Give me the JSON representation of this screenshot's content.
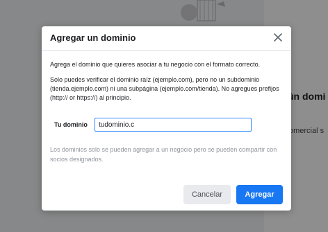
{
  "background": {
    "heading": "ún domi",
    "subtext": "omercial s"
  },
  "dialog": {
    "title": "Agregar un dominio",
    "paragraph1": "Agrega el dominio que quieres asociar a tu negocio con el formato correcto.",
    "paragraph2": "Solo puedes verificar el dominio raíz (ejemplo.com), pero no un subdominio (tienda.ejemplo.com) ni una subpágina (ejemplo.com/tienda). No agregues prefijos (http:// or https://) al principio.",
    "field_label": "Tu dominio",
    "field_value": "tudominio.c",
    "hint": "Los dominios solo se pueden agregar a un negocio pero se pueden compartir con socios designados.",
    "cancel_label": "Cancelar",
    "add_label": "Agregar"
  },
  "colors": {
    "primary": "#1877f2",
    "input_border": "#2d88ff",
    "hint_text": "#90949c"
  },
  "icons": {
    "close": "close-icon"
  }
}
